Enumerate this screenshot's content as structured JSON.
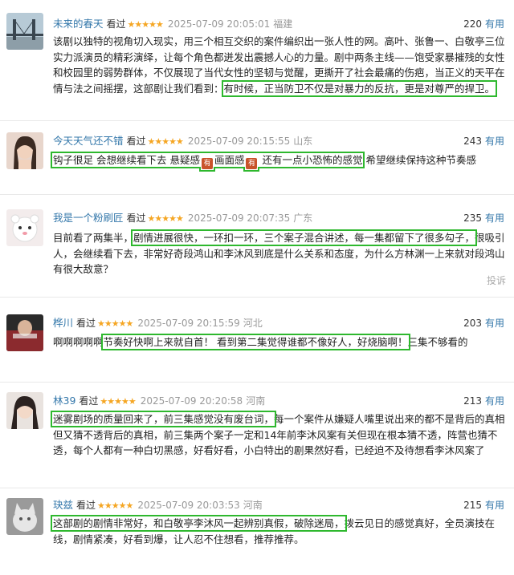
{
  "reviews": [
    {
      "user": "未来的春天",
      "watched": "看过",
      "stars": "★★★★★",
      "time": "2025-07-09 20:05:01",
      "location": "福建",
      "useful_count": "220",
      "useful_label": "有用",
      "text_before": "该剧以独特的视角切入现实，用三个相互交织的案件编织出一张人性的网。高叶、张鲁一、白敬亭三位实力派演员的精彩演绎，让每个角色都迸发出震撼人心的力量。剧中两条主线——饱受家暴摧残的女性和校园里的弱势群体，不仅展现了当代女性的坚韧与觉醒，更撕开了社会最痛的伤疤，当正义的天平在情与法之间摇摆，这部剧让我们看到：",
      "highlight": "有时候，正当防卫不仅是对暴力的反抗，更是对尊严的捍卫。",
      "text_after": ""
    },
    {
      "user": "今天天气还不错",
      "watched": "看过",
      "stars": "★★★★★",
      "time": "2025-07-09 20:15:55",
      "location": "山东",
      "useful_count": "243",
      "useful_label": "有用",
      "highlight_a": "钩子很足 会想继续看下去 悬疑感",
      "emoji_1": "有",
      "highlight_b": "画面感",
      "emoji_2": "有",
      "highlight_c": " 还有一点小恐怖的感觉",
      "text_after": "希望继续保持这种节奏感"
    },
    {
      "user": "我是一个粉刷匠",
      "watched": "看过",
      "stars": "★★★★★",
      "time": "2025-07-09 20:07:35",
      "location": "广东",
      "useful_count": "235",
      "useful_label": "有用",
      "text_before": "目前看了两集半，",
      "highlight": "剧情进展很快，一环扣一环，三个案子混合讲述，每一集都留下了很多勾子，",
      "text_after": "很吸引人，会继续看下去，非常好奇段鸿山和李沐风到底是什么关系和态度，为什么方林渊一上来就对段鸿山有很大敌意？",
      "report": "投诉"
    },
    {
      "user": "桦川",
      "watched": "看过",
      "stars": "★★★★★",
      "time": "2025-07-09 20:15:59",
      "location": "河北",
      "useful_count": "203",
      "useful_label": "有用",
      "text_before": "啊啊啊啊啊",
      "highlight": "节奏好快啊上来就自首！ 看到第二集觉得谁都不像好人，好烧脑啊！",
      "text_after": "三集不够看的"
    },
    {
      "user": "林39",
      "watched": "看过",
      "stars": "★★★★★",
      "time": "2025-07-09 20:20:58",
      "location": "河南",
      "useful_count": "213",
      "useful_label": "有用",
      "text_before": "",
      "highlight": "迷雾剧场的质量回来了，前三集感觉没有废台词，",
      "text_after": "每一个案件从嫌疑人嘴里说出来的都不是背后的真相但又猜不透背后的真相，前三集两个案子一定和14年前李沐风案有关但现在根本猜不透，阵营也猜不透，每个人都有一种白切黑感，好看好看，小白特出的剧果然好看，已经迫不及待想看李沐风案了"
    },
    {
      "user": "玦兹",
      "watched": "看过",
      "stars": "★★★★★",
      "time": "2025-07-09 20:03:53",
      "location": "河南",
      "useful_count": "215",
      "useful_label": "有用",
      "text_before": "",
      "highlight": "这部剧的剧情非常好，和白敬亭李沐风一起辨别真假，破除迷局，",
      "text_after": "拨云见日的感觉真好，全员演技在线，剧情紧凑，好看到爆，让人忍不住想看，推荐推荐。"
    }
  ]
}
